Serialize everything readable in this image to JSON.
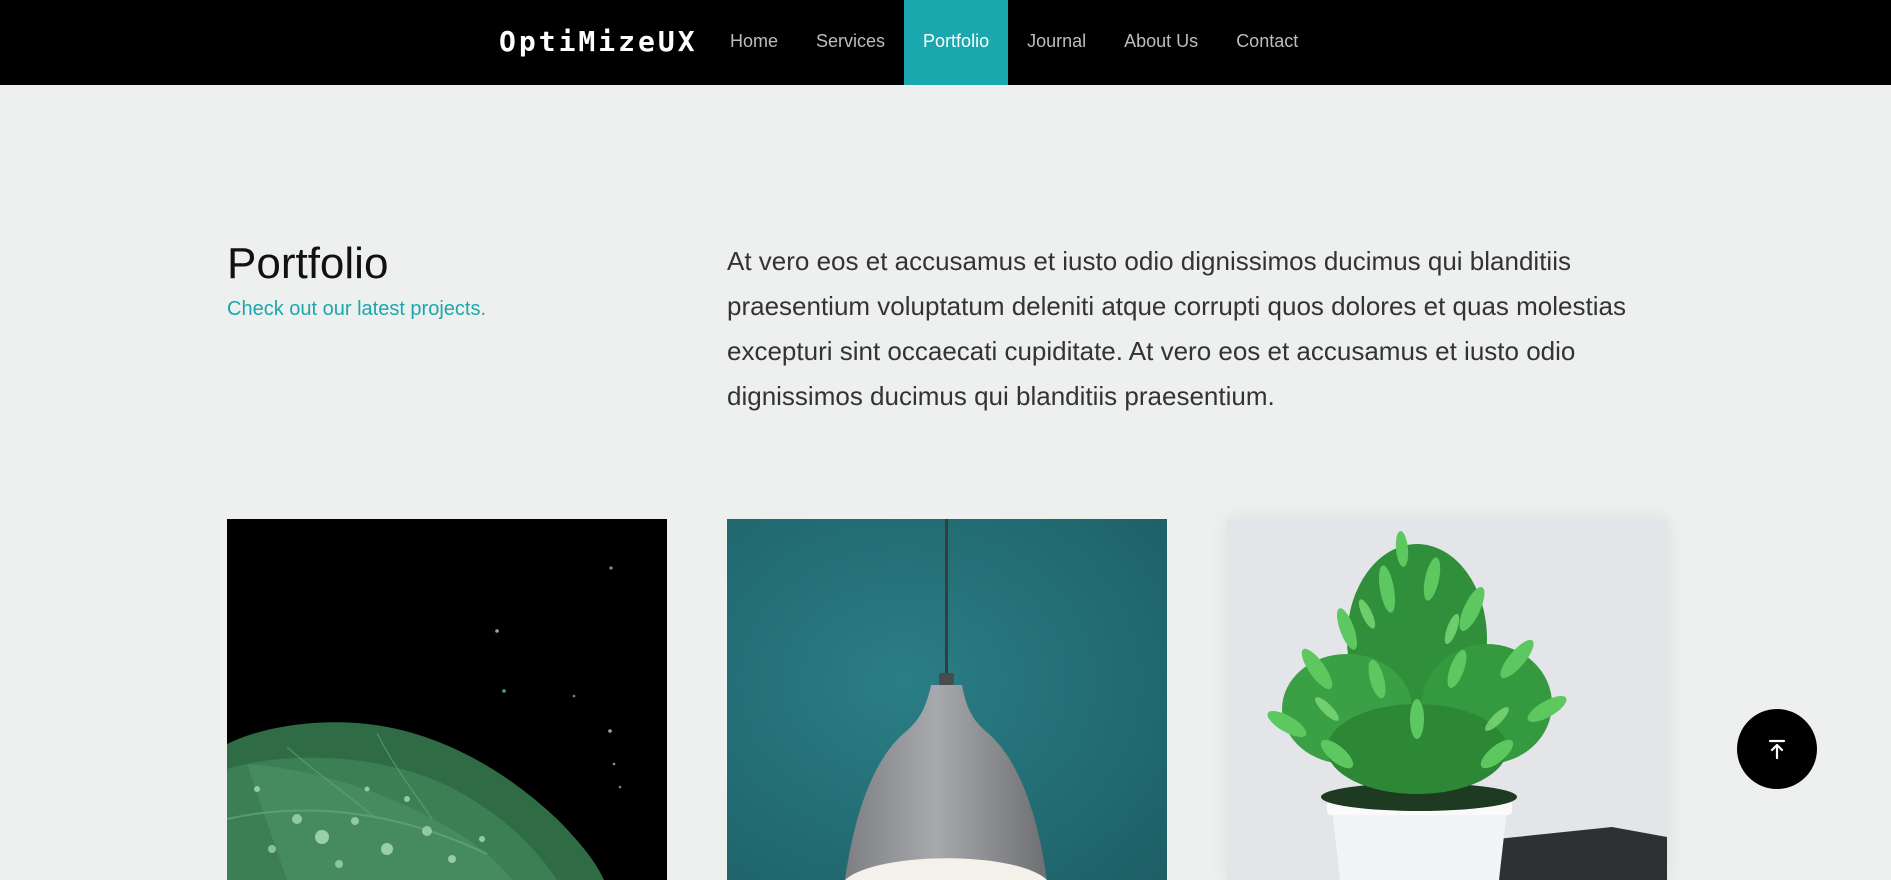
{
  "brand": {
    "name": "OptiMizeUX"
  },
  "nav": {
    "items": [
      {
        "label": "Home"
      },
      {
        "label": "Services"
      },
      {
        "label": "Portfolio",
        "active": true
      },
      {
        "label": "Journal"
      },
      {
        "label": "About Us"
      },
      {
        "label": "Contact"
      }
    ]
  },
  "header": {
    "title": "Portfolio",
    "subtitle": "Check out our latest projects.",
    "intro": "At vero eos et accusamus et iusto odio dignissimos ducimus qui blanditiis praesentium voluptatum deleniti atque corrupti quos dolores et quas molestias excepturi sint occaecati cupiditate. At vero eos et accusamus et iusto odio dignissimos ducimus qui blanditiis praesentium."
  },
  "portfolio": {
    "items": [
      {
        "image": "leaf-with-water-drops"
      },
      {
        "image": "pendant-lamp"
      },
      {
        "image": "potted-plant"
      }
    ]
  },
  "back_to_top": {
    "icon": "arrow-up-to-line-icon"
  },
  "colors": {
    "accent": "#1aa7ad",
    "navbar": "#000000",
    "page_background": "#eef0ef"
  }
}
